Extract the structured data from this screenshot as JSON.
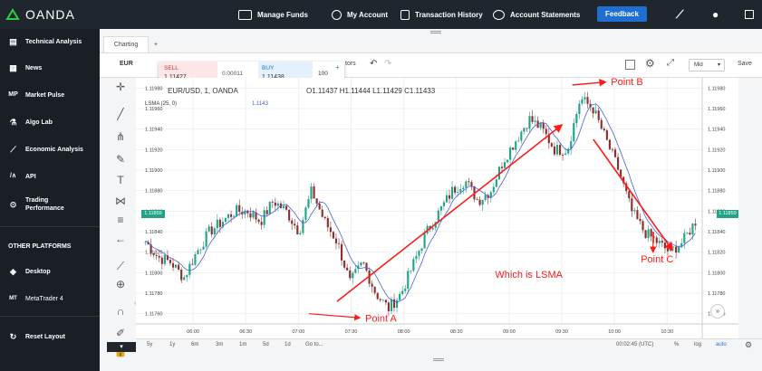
{
  "topbar": {
    "logo": "OANDA",
    "manage_funds": "Manage Funds",
    "my_account": "My Account",
    "transaction_history": "Transaction History",
    "account_statements": "Account Statements",
    "feedback": "Feedback"
  },
  "sidebar": {
    "items": [
      {
        "label": "Technical Analysis",
        "icon": "technical-analysis-icon"
      },
      {
        "label": "News",
        "icon": "news-icon"
      },
      {
        "label": "Market Pulse",
        "icon": "market-pulse-icon"
      },
      {
        "label": "Algo Lab",
        "icon": "flask-icon"
      },
      {
        "label": "Economic Analysis",
        "icon": "economic-analysis-icon"
      },
      {
        "label": "API",
        "icon": "api-icon"
      },
      {
        "label": "Trading",
        "label2": "Performance",
        "icon": "trading-performance-icon"
      }
    ],
    "other_platforms_title": "OTHER PLATFORMS",
    "platforms": [
      {
        "label": "Desktop",
        "icon": "desktop-icon"
      },
      {
        "label": "MetaTrader 4",
        "icon": "metatrader-icon"
      }
    ],
    "reset_layout": "Reset Layout"
  },
  "tabs": {
    "charting": "Charting",
    "add": "+"
  },
  "toolbar": {
    "symbol": "EUR",
    "indicators": "tors",
    "mid": "Mid",
    "save": "Save"
  },
  "quote": {
    "sell_label": "SELL",
    "sell_price": "1.11427",
    "spread": "0.00011",
    "buy_label": "BUY",
    "buy_price": "1.11438",
    "units": "100",
    "plus": "+",
    "minus": "−"
  },
  "chart_header": {
    "title": "EUR/USD, 1, OANDA",
    "ohlc": "O1.11437  H1.11444  L1.11429  C1.11433",
    "indicator": "LSMA (25, 0)",
    "indicator_value": "1.1143",
    "last_price": "1.11859"
  },
  "bottom": {
    "ranges": [
      "5y",
      "1y",
      "6m",
      "3m",
      "1m",
      "5d",
      "1d",
      "Go to..."
    ],
    "clock": "00:02:45 (UTC)",
    "percent": "%",
    "log": "log",
    "auto": "auto"
  },
  "colors": {
    "up": "#22a387",
    "down": "#8b2f2f",
    "lsma": "#4a5fd8",
    "annotation": "#ff1a1a",
    "accent": "#1f6fd1"
  },
  "chart_data": {
    "type": "candlestick",
    "symbol": "EUR/USD",
    "interval": "1",
    "y_ticks": [
      "1.11980",
      "1.11960",
      "1.11940",
      "1.11920",
      "1.11900",
      "1.11880",
      "1.11860",
      "1.11840",
      "1.11820",
      "1.11800",
      "1.11780",
      "1.11760"
    ],
    "ylim": [
      1.1175,
      1.1199
    ],
    "x_ticks": [
      "06:00",
      "06:30",
      "07:00",
      "07:30",
      "08:00",
      "08:30",
      "09:00",
      "09:30",
      "10:00",
      "10:30"
    ],
    "close_path": [
      1.1183,
      1.11815,
      1.1181,
      1.11795,
      1.1182,
      1.1184,
      1.1185,
      1.1186,
      1.1186,
      1.1185,
      1.1187,
      1.1186,
      1.1184,
      1.1188,
      1.1185,
      1.1183,
      1.1179,
      1.1181,
      1.1178,
      1.11765,
      1.1178,
      1.1181,
      1.1184,
      1.1186,
      1.1188,
      1.1189,
      1.1187,
      1.1188,
      1.1191,
      1.1193,
      1.1195,
      1.1194,
      1.1192,
      1.1192,
      1.1197,
      1.1196,
      1.1193,
      1.119,
      1.1186,
      1.1184,
      1.1183,
      1.1182,
      1.1183,
      1.1185
    ],
    "annotations": [
      {
        "text": "Point A",
        "x": "07:35",
        "y": 1.11755
      },
      {
        "text": "Point B",
        "x": "09:55",
        "y": 1.11985
      },
      {
        "text": "Point C",
        "x": "10:25",
        "y": 1.11812
      },
      {
        "text": "Which is   LSMA",
        "x": "09:30",
        "y": 1.11795
      }
    ]
  }
}
